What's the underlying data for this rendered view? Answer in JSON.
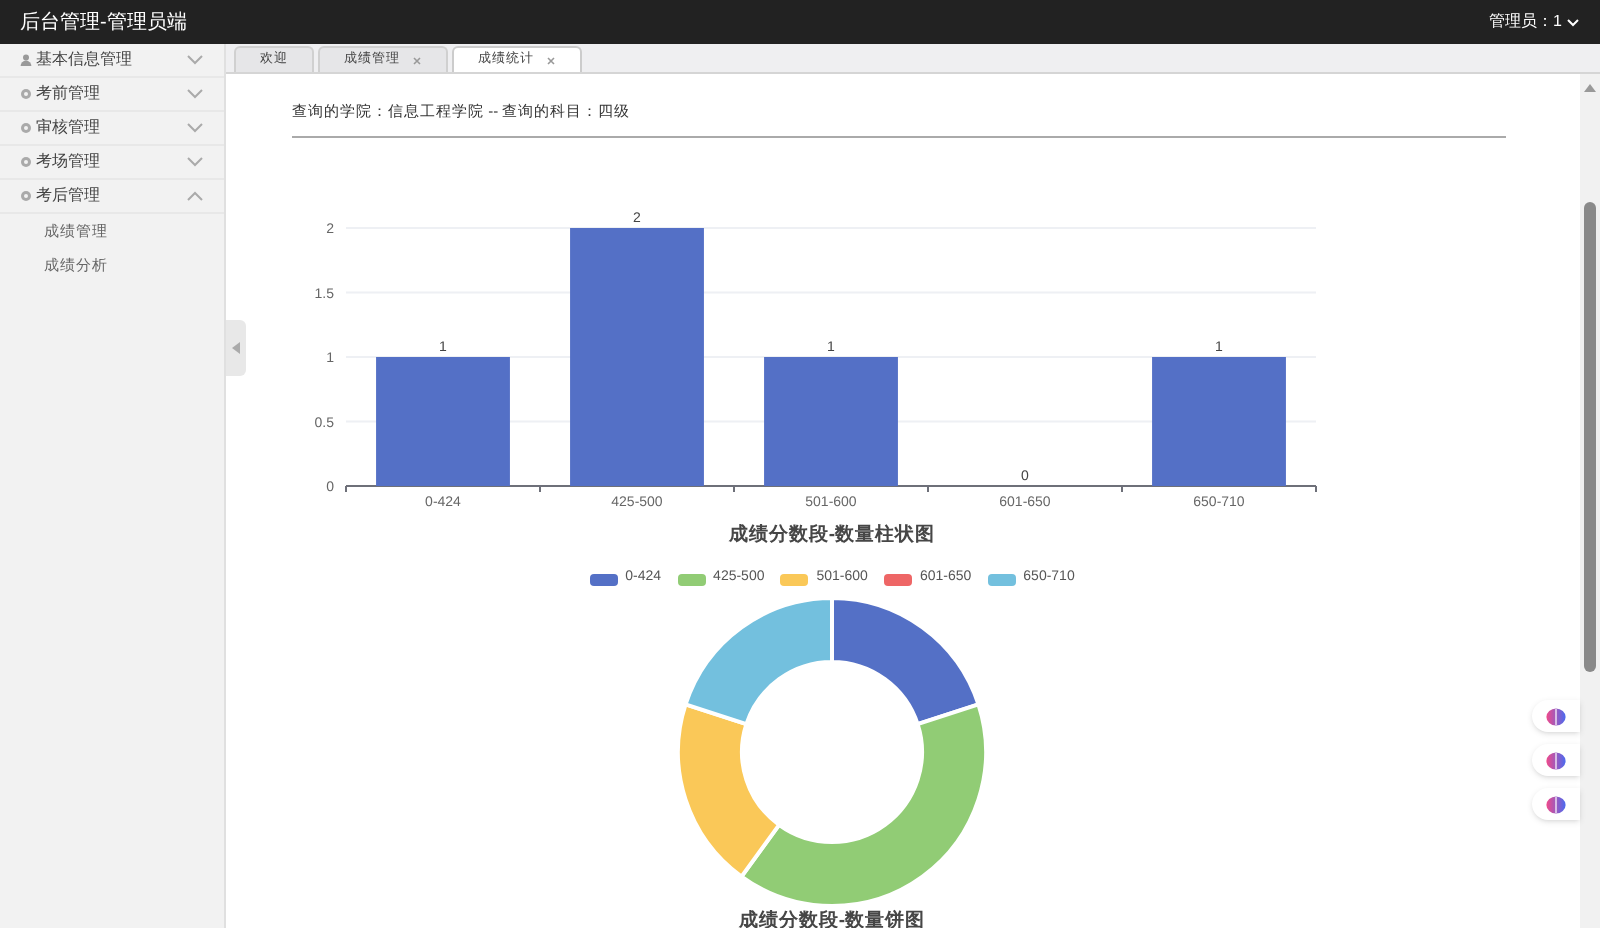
{
  "header": {
    "title": "后台管理-管理员端",
    "user": "管理员：1"
  },
  "sidebar": {
    "items": [
      {
        "label": "基本信息管理",
        "expanded": false
      },
      {
        "label": "考前管理",
        "expanded": false
      },
      {
        "label": "审核管理",
        "expanded": false
      },
      {
        "label": "考场管理",
        "expanded": false
      },
      {
        "label": "考后管理",
        "expanded": true,
        "children": [
          {
            "label": "成绩管理"
          },
          {
            "label": "成绩分析"
          }
        ]
      }
    ]
  },
  "tabs": [
    {
      "label": "欢迎",
      "selected": false,
      "closable": false
    },
    {
      "label": "成绩管理",
      "selected": false,
      "closable": true
    },
    {
      "label": "成绩统计",
      "selected": true,
      "closable": true
    }
  ],
  "query": "查询的学院：信息工程学院 -- 查询的科目：四级",
  "bar_chart": {
    "title": "成绩分数段-数量柱状图",
    "chart_data": {
      "type": "bar",
      "categories": [
        "0-424",
        "425-500",
        "501-600",
        "601-650",
        "650-710"
      ],
      "series": [
        {
          "color": "#5470c6",
          "values": [
            1,
            2,
            1,
            0,
            1
          ]
        }
      ],
      "ylim": [
        0,
        2
      ],
      "yticks": [
        0,
        0.5,
        1,
        1.5,
        2
      ],
      "grid": true,
      "data_labels": true
    }
  },
  "pie_chart": {
    "title": "成绩分数段-数量饼图",
    "chart_data": {
      "type": "donut",
      "categories": [
        "0-424",
        "425-500",
        "501-600",
        "601-650",
        "650-710"
      ],
      "series": [
        {
          "values": [
            20,
            40,
            20,
            0,
            20
          ]
        }
      ],
      "colors": [
        "#5470c6",
        "#91cc75",
        "#fac858",
        "#ee6666",
        "#73c0de"
      ]
    }
  }
}
